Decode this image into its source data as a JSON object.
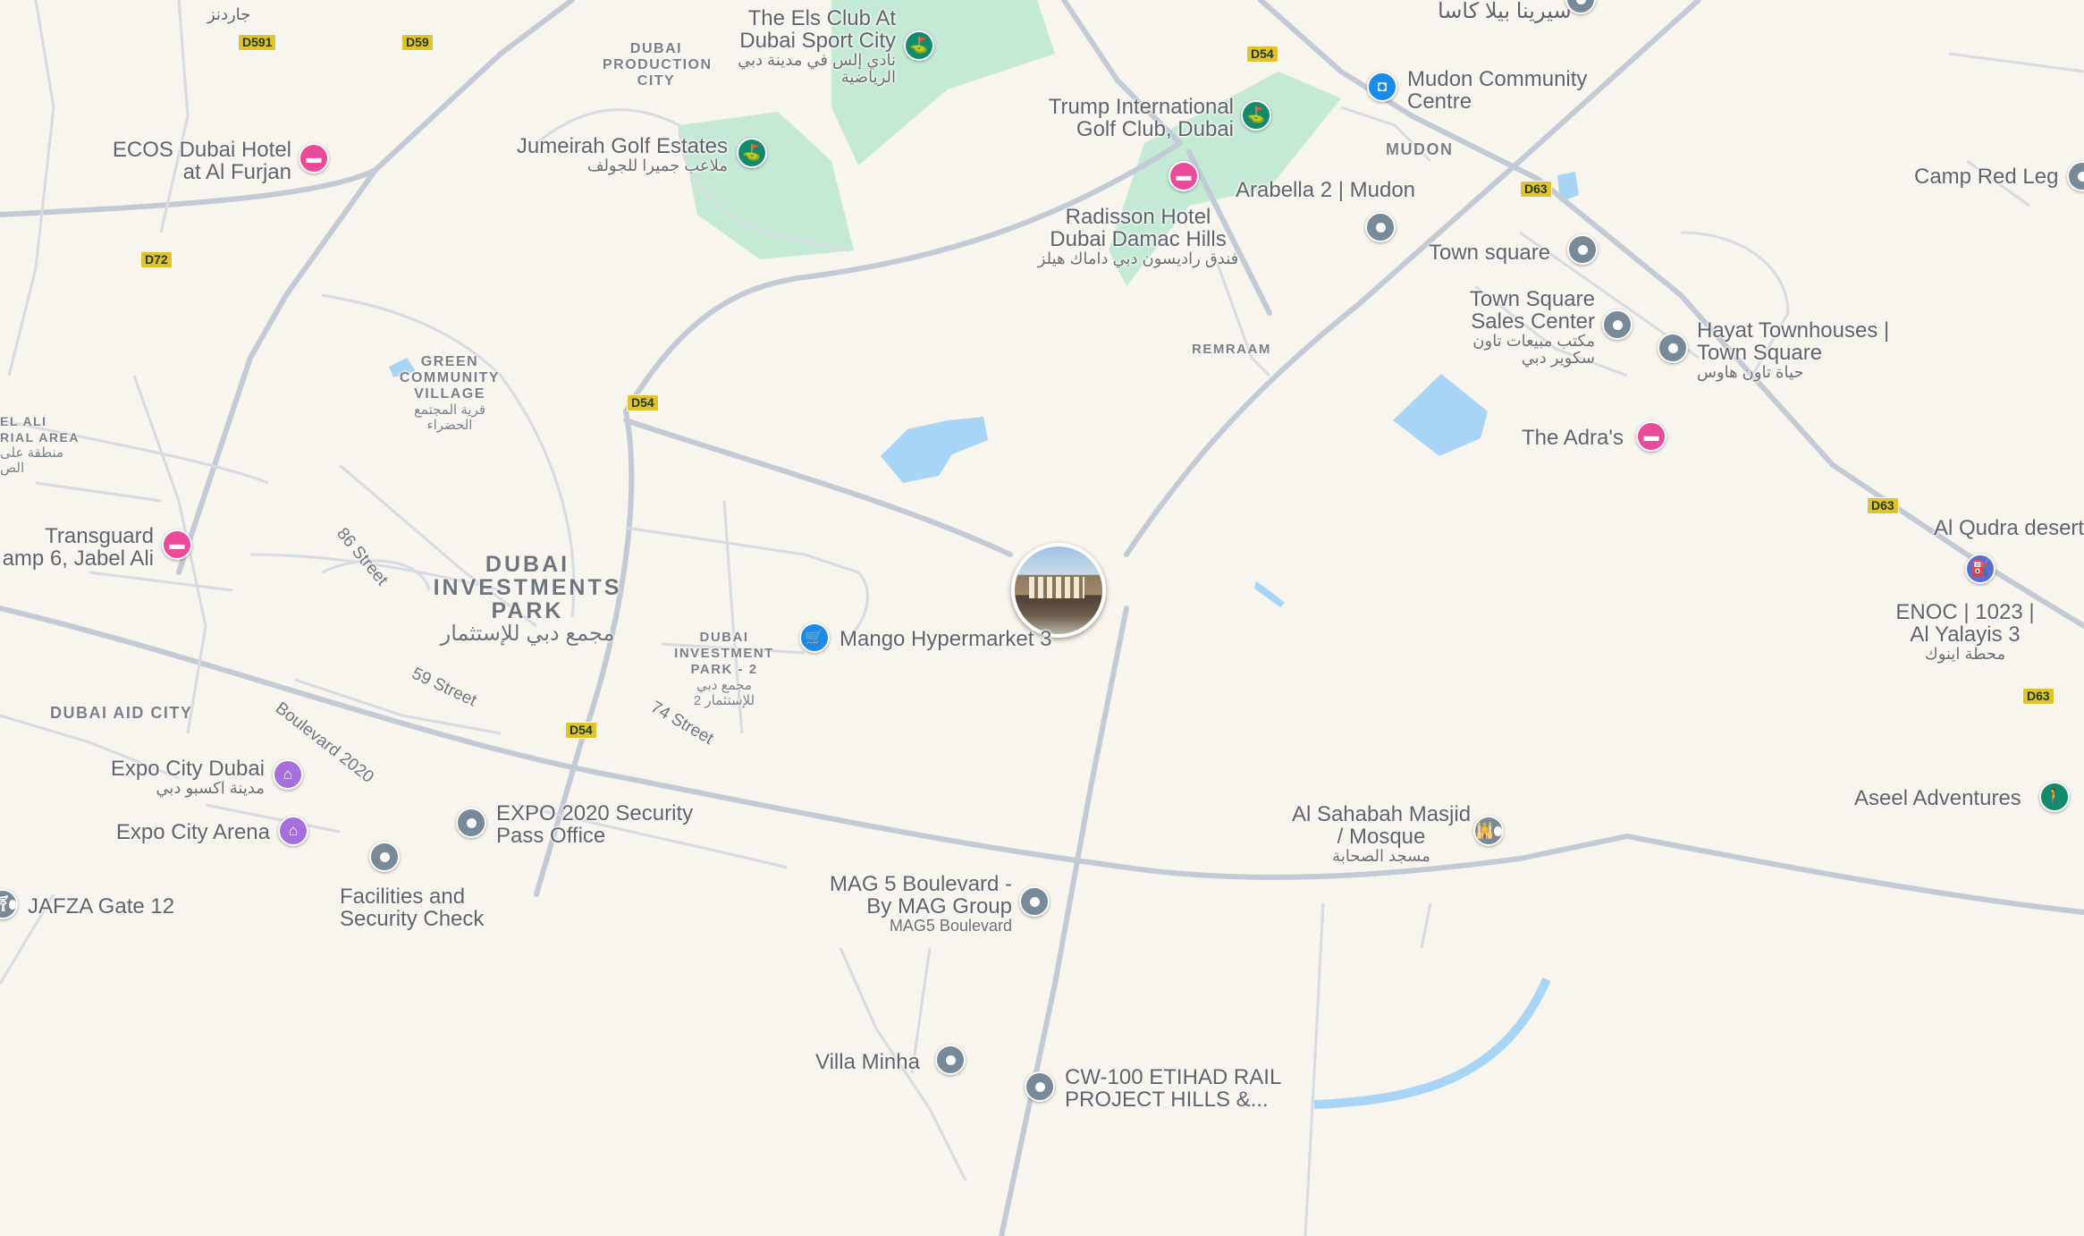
{
  "map": {
    "selected_place_photo": "photo-marker",
    "area_labels": [
      {
        "id": "dubai-production-city",
        "text": "DUBAI PRODUCTION CITY"
      },
      {
        "id": "green-community",
        "text": "GREEN COMMUNITY VILLAGE",
        "ar": "قرية المجتمع الحضراء"
      },
      {
        "id": "dubai-investments-park",
        "text": "DUBAI INVESTMENTS PARK",
        "ar": "مجمع دبي للإستثمار"
      },
      {
        "id": "dip-2",
        "text": "DUBAI INVESTMENT PARK - 2",
        "ar": "مجمع دبي للإستثمار 2"
      },
      {
        "id": "dubai-aid-city",
        "text": "DUBAI AID CITY"
      },
      {
        "id": "mudon",
        "text": "MUDON"
      },
      {
        "id": "remraam",
        "text": "REMRAAM"
      },
      {
        "id": "jebel-ali-ind",
        "text": "EL ALI RIAL AREA",
        "ar": "منطقة على الص"
      }
    ],
    "streets": [
      {
        "id": "86-street",
        "text": "86 Street"
      },
      {
        "id": "59-street",
        "text": "59 Street"
      },
      {
        "id": "74-street",
        "text": "74 Street"
      },
      {
        "id": "boulevard-2020",
        "text": "Boulevard 2020"
      }
    ],
    "road_shields": [
      "D591",
      "D59",
      "D72",
      "D54",
      "D54",
      "D54",
      "D63",
      "D63",
      "D63"
    ],
    "places": [
      {
        "id": "els-club",
        "name": "The Els Club At Dubai Sport City",
        "ar": "نادي إلس في مدينة دبي الرياضية",
        "icon": "golf-icon",
        "color": "#128a6c"
      },
      {
        "id": "trump-golf",
        "name": "Trump International Golf Club, Dubai",
        "icon": "golf-icon",
        "color": "#128a6c"
      },
      {
        "id": "jumeirah-golf",
        "name": "Jumeirah Golf Estates",
        "ar": "ملاعب جميرا للجولف",
        "icon": "golf-icon",
        "color": "#128a6c"
      },
      {
        "id": "ecos-dubai",
        "name": "ECOS Dubai Hotel at Al Furjan",
        "icon": "hotel-icon",
        "color": "#ea4a98"
      },
      {
        "id": "mudon-community",
        "name": "Mudon Community Centre",
        "icon": "shopping-bag-icon",
        "color": "#1a8be8"
      },
      {
        "id": "arabella-2",
        "name": "Arabella 2 | Mudon",
        "icon": "place-pin-icon",
        "color": "#788a97"
      },
      {
        "id": "radisson",
        "name": "Radisson Hotel Dubai Damac Hills",
        "ar": "فندق راديسون دبي داماك هيلز",
        "icon": "hotel-icon",
        "color": "#ea4a98"
      },
      {
        "id": "camp-red-leg",
        "name": "Camp Red Leg",
        "icon": "place-pin-icon",
        "color": "#788a97"
      },
      {
        "id": "town-square",
        "name": "Town square",
        "icon": "place-pin-icon",
        "color": "#788a97"
      },
      {
        "id": "town-square-sales",
        "name": "Town Square Sales Center",
        "ar": "مكتب مبيعات تاون سكوير دبي",
        "icon": "place-pin-icon",
        "color": "#788a97"
      },
      {
        "id": "hayat-townhouses",
        "name": "Hayat Townhouses | Town Square",
        "ar": "حياة تاون هاوس",
        "icon": "place-pin-icon",
        "color": "#788a97"
      },
      {
        "id": "the-adras",
        "name": "The Adra's",
        "icon": "hotel-icon",
        "color": "#ea4a98"
      },
      {
        "id": "al-qudra",
        "name": "Al Qudra desert",
        "icon": "place-pin-icon",
        "color": "#788a97"
      },
      {
        "id": "enoc-1023",
        "name": "ENOC | 1023 | Al Yalayis 3",
        "ar": "محطة اينوك",
        "icon": "gas-station-icon",
        "color": "#5a6ed4"
      },
      {
        "id": "transguard",
        "name": "Transguard amp 6, Jabel Ali",
        "icon": "hotel-icon",
        "color": "#ea4a98"
      },
      {
        "id": "mango-hypermarket",
        "name": "Mango Hypermarket 3",
        "icon": "shopping-cart-icon",
        "color": "#1a8be8"
      },
      {
        "id": "expo-city-dubai",
        "name": "Expo City Dubai",
        "ar": "مدينة اكسبو دبي",
        "icon": "landmark-icon",
        "color": "#a670dc"
      },
      {
        "id": "expo-city-arena",
        "name": "Expo City Arena",
        "icon": "landmark-icon",
        "color": "#a670dc"
      },
      {
        "id": "expo-security",
        "name": "EXPO 2020 Security Pass Office",
        "icon": "place-pin-icon",
        "color": "#788a97"
      },
      {
        "id": "facilities-security",
        "name": "Facilities and Security Check",
        "icon": "place-pin-icon",
        "color": "#788a97"
      },
      {
        "id": "jafza-gate",
        "name": "JAFZA Gate 12",
        "icon": "gate-icon",
        "color": "#788a97"
      },
      {
        "id": "mag5",
        "name": "MAG 5 Boulevard - By MAG Group",
        "ar": "MAG5 Boulevard",
        "icon": "place-pin-icon",
        "color": "#788a97"
      },
      {
        "id": "al-sahabah",
        "name": "Al Sahabah Masjid / Mosque",
        "ar": "مسجد الصحابة",
        "icon": "mosque-icon",
        "color": "#788a97"
      },
      {
        "id": "aseel",
        "name": "Aseel Adventures",
        "icon": "hiking-icon",
        "color": "#128a6c"
      },
      {
        "id": "villa-minha",
        "name": "Villa Minha",
        "icon": "place-pin-icon",
        "color": "#788a97"
      },
      {
        "id": "cw-100",
        "name": "CW-100 ETIHAD RAIL PROJECT HILLS &...",
        "icon": "place-pin-icon",
        "color": "#788a97"
      },
      {
        "id": "serena-casa",
        "name": "سيرينا بيلا كاسا",
        "icon": "place-pin-icon",
        "color": "#788a97"
      },
      {
        "id": "gardens-top",
        "name": "جاردنز"
      }
    ],
    "colors": {
      "land": "#f8f4ee",
      "road": "#d6dbe2",
      "major_road": "#c2cad6",
      "water": "#a8d5f5",
      "park": "#c4ead6",
      "shield": "#e2c12b"
    }
  }
}
